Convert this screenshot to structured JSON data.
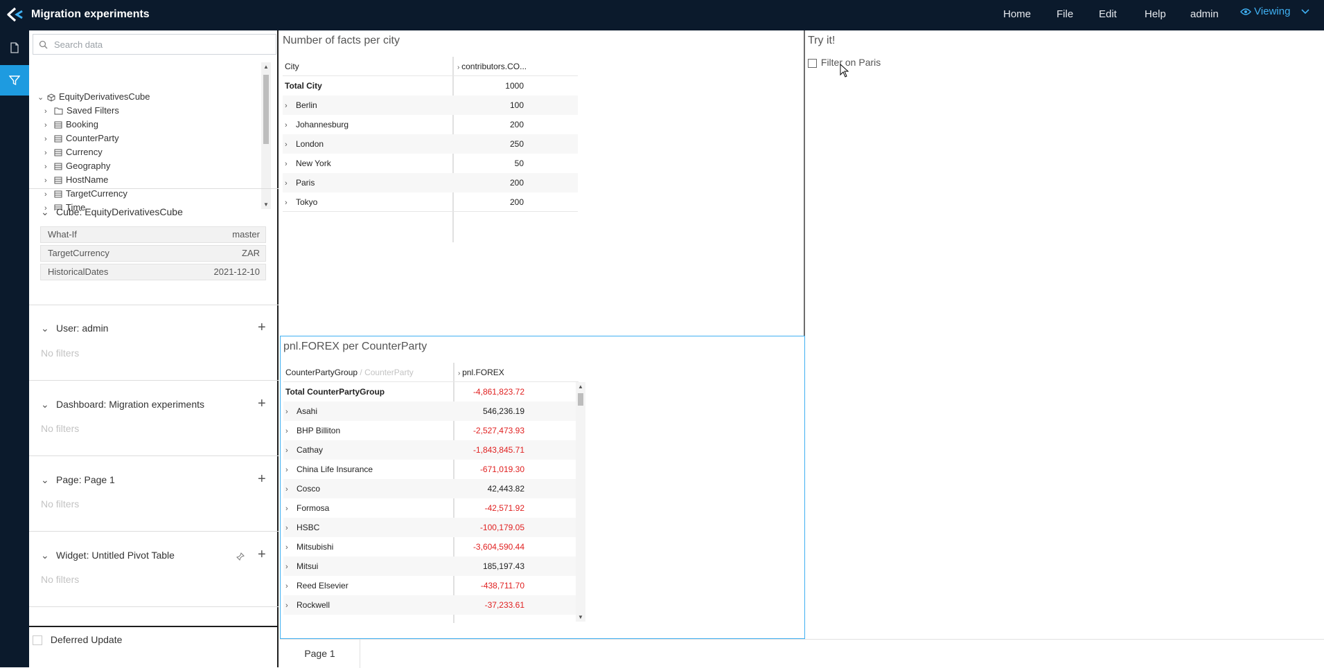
{
  "app": {
    "title": "Migration experiments",
    "nav": [
      "Home",
      "File",
      "Edit",
      "Help",
      "admin"
    ],
    "mode": "Viewing",
    "accent": "#1e9be0"
  },
  "sidebar": {
    "search_placeholder": "Search data",
    "tree": [
      {
        "label": "EquityDerivativesCube",
        "icon": "cube-icon",
        "level": 0
      },
      {
        "label": "Saved Filters",
        "icon": "folder-icon",
        "level": 1
      },
      {
        "label": "Booking",
        "icon": "table-icon",
        "level": 1
      },
      {
        "label": "CounterParty",
        "icon": "table-icon",
        "level": 1
      },
      {
        "label": "Currency",
        "icon": "table-icon",
        "level": 1
      },
      {
        "label": "Geography",
        "icon": "table-icon",
        "level": 1
      },
      {
        "label": "HostName",
        "icon": "table-icon",
        "level": 1
      },
      {
        "label": "TargetCurrency",
        "icon": "table-icon",
        "level": 1
      },
      {
        "label": "Time",
        "icon": "table-icon",
        "level": 1
      }
    ],
    "cube_section": {
      "title": "Cube: EquityDerivativesCube",
      "filters": [
        {
          "key": "What-If",
          "value": "master"
        },
        {
          "key": "TargetCurrency",
          "value": "ZAR"
        },
        {
          "key": "HistoricalDates",
          "value": "2021-12-10"
        }
      ]
    },
    "sections": [
      {
        "title": "User: admin",
        "empty": "No filters"
      },
      {
        "title": "Dashboard: Migration experiments",
        "empty": "No filters"
      },
      {
        "title": "Page: Page 1",
        "empty": "No filters"
      },
      {
        "title": "Widget: Untitled Pivot Table",
        "empty": "No filters"
      }
    ],
    "deferred_update": "Deferred Update"
  },
  "widgets": {
    "facts": {
      "title": "Number of facts per city",
      "col1": "City",
      "col2": "contributors.CO...",
      "rows": [
        {
          "label": "Total City",
          "value": "1000",
          "total": true
        },
        {
          "label": "Berlin",
          "value": "100"
        },
        {
          "label": "Johannesburg",
          "value": "200"
        },
        {
          "label": "London",
          "value": "250"
        },
        {
          "label": "New York",
          "value": "50"
        },
        {
          "label": "Paris",
          "value": "200"
        },
        {
          "label": "Tokyo",
          "value": "200"
        }
      ]
    },
    "tryit": {
      "title": "Try it!",
      "checkbox_label": "Filter on Paris"
    },
    "pnl": {
      "title": "pnl.FOREX per CounterParty",
      "col1": "CounterPartyGroup",
      "col1_sub": "/ CounterParty",
      "col2": "pnl.FOREX",
      "rows": [
        {
          "label": "Total CounterPartyGroup",
          "value": "-4,861,823.72",
          "total": true,
          "neg": true
        },
        {
          "label": "Asahi",
          "value": "546,236.19",
          "neg": false
        },
        {
          "label": "BHP Billiton",
          "value": "-2,527,473.93",
          "neg": true
        },
        {
          "label": "Cathay",
          "value": "-1,843,845.71",
          "neg": true
        },
        {
          "label": "China Life Insurance",
          "value": "-671,019.30",
          "neg": true
        },
        {
          "label": "Cosco",
          "value": "42,443.82",
          "neg": false
        },
        {
          "label": "Formosa",
          "value": "-42,571.92",
          "neg": true
        },
        {
          "label": "HSBC",
          "value": "-100,179.05",
          "neg": true
        },
        {
          "label": "Mitsubishi",
          "value": "-3,604,590.44",
          "neg": true
        },
        {
          "label": "Mitsui",
          "value": "185,197.43",
          "neg": false
        },
        {
          "label": "Reed Elsevier",
          "value": "-438,711.70",
          "neg": true
        },
        {
          "label": "Rockwell",
          "value": "-37,233.61",
          "neg": true
        }
      ]
    }
  },
  "pages": [
    "Page 1"
  ]
}
